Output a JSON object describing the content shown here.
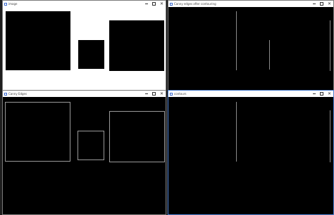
{
  "windows": {
    "image": {
      "title": "image"
    },
    "canny_after": {
      "title": "Canny edges after contouring"
    },
    "canny_edges": {
      "title": "Canny Edges"
    },
    "contours": {
      "title": "contours"
    }
  },
  "controls": {
    "minimize": "",
    "maximize": "",
    "close": "✕"
  }
}
